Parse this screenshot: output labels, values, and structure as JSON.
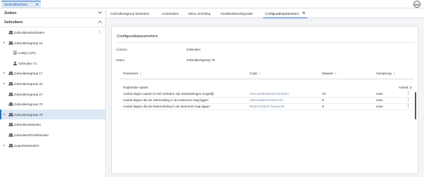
{
  "app": {
    "tab_label": "Gebruikbeheer",
    "tab_close": "✕",
    "avatar_initials": "GG"
  },
  "sidebar": {
    "search_label": "Zoeken",
    "users_label": "Gebruikers",
    "items": [
      {
        "label": "GebruikersExKlanten",
        "level": 1,
        "caret": "",
        "icon": "users-icon"
      },
      {
        "label": "Gebruikersgroep 16",
        "level": 1,
        "caret": "▾",
        "icon": "users-icon"
      },
      {
        "label": "Carlijn (API)",
        "level": 2,
        "caret": "",
        "icon": "user-circle-icon"
      },
      {
        "label": "Gebruiker 71",
        "level": 2,
        "caret": "",
        "icon": "user-icon"
      },
      {
        "label": "Gebruikersgroep 17",
        "level": 1,
        "caret": "▸",
        "icon": "users-icon"
      },
      {
        "label": "Gebruikersgroep 20",
        "level": 1,
        "caret": "▸",
        "icon": "users-icon"
      },
      {
        "label": "Gebruikersgroep 27",
        "level": 1,
        "caret": "",
        "icon": "users-icon"
      },
      {
        "label": "Gebruikersgroep 70",
        "level": 1,
        "caret": "",
        "icon": "users-icon"
      },
      {
        "label": "Gebruikersgroep 76",
        "level": 1,
        "caret": "▾",
        "icon": "users-icon"
      },
      {
        "label": "GebruikersKlanten",
        "level": 1,
        "caret": "",
        "icon": "users-icon"
      },
      {
        "label": "GebruikersProefKlanten",
        "level": 1,
        "caret": "",
        "icon": "users-icon"
      },
      {
        "label": "Superbeheerders",
        "level": 1,
        "caret": "▸",
        "icon": "users-icon"
      }
    ],
    "more_glyph": "⋮",
    "chevron_glyph": "⌄"
  },
  "tabs": [
    {
      "label": "Gebruikersgroep bewerken"
    },
    {
      "label": "Autorisaties"
    },
    {
      "label": "Menu inrichting"
    },
    {
      "label": "Klantbeeldconfiguratie"
    },
    {
      "label": "Configuratieparameters",
      "close": "✕"
    }
  ],
  "panel": {
    "title": "Configuratieparameters",
    "context_label": "Context",
    "context_value": "Gebruiker",
    "name_label": "Naam",
    "name_value": "Gebruikersgroep 76",
    "columns": {
      "param": "Parameter",
      "code": "Code",
      "value": "Waarde",
      "origin": "Oorsprong",
      "sort": "⇕"
    },
    "group_label": "Registratie opties",
    "count_label": "Aantal:",
    "count_value": "3",
    "rows": [
      {
        "param": "Aantal dagen waarin in het verleden zijn aanpassingen mogelijk",
        "code": "VerzuimMutatiesInVerleden",
        "value": "10",
        "origin": "User",
        "more": "⋮"
      },
      {
        "param": "Aantal dagen dat de ziekmelding in de toekomst mag liggen",
        "code": "ZiekmeldenInToekomst",
        "value": "8",
        "origin": "User",
        "more": "⋮"
      },
      {
        "param": "Aantal dagen dat de betermelding in de toekomst mag liggen",
        "code": "BetermeldenInToekomst",
        "value": "9",
        "origin": "User",
        "more": "⋮"
      }
    ]
  },
  "colors": {
    "accent": "#2c6fc4",
    "selected_bg": "#dce8f6",
    "code_text": "#7a8fa8"
  }
}
